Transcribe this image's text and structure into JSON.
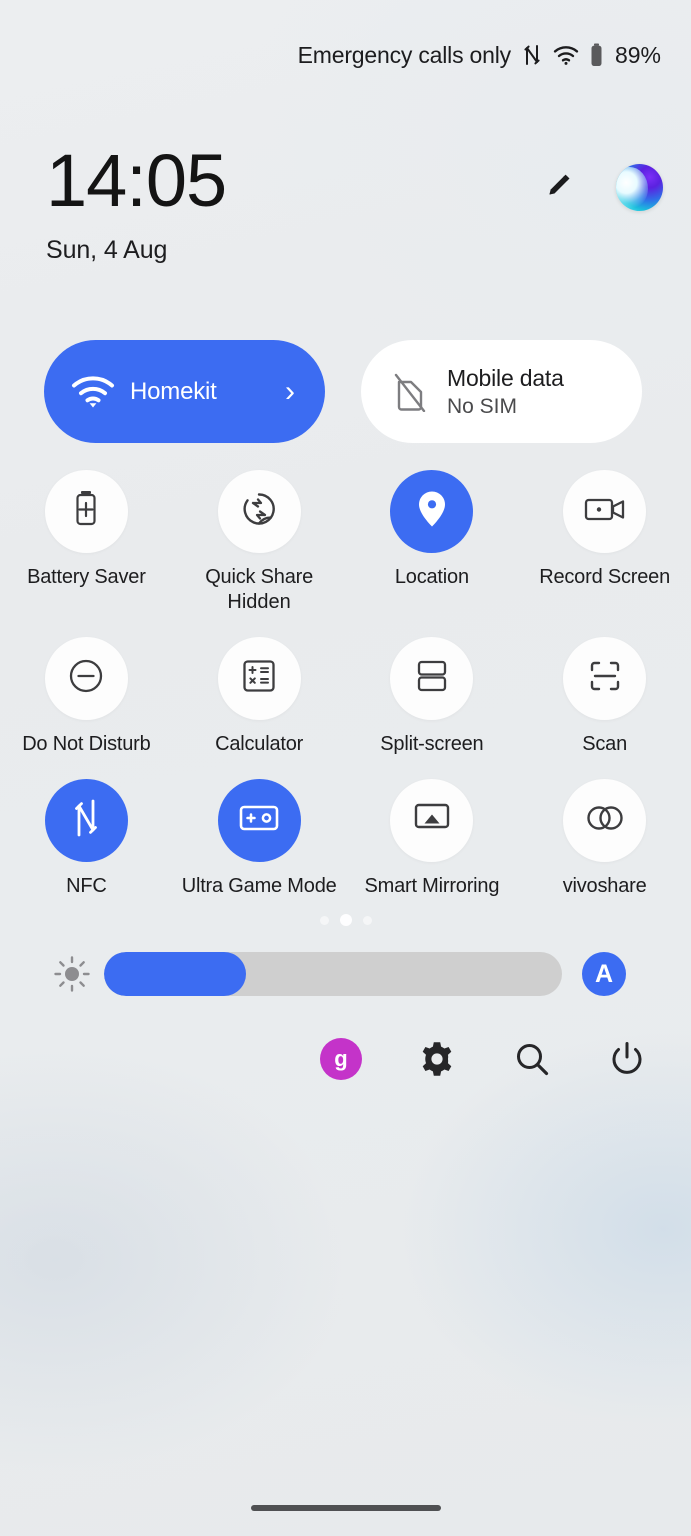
{
  "statusbar": {
    "carrier_text": "Emergency calls only",
    "nfc_icon": "nfc-icon",
    "wifi_icon": "wifi-icon",
    "battery_icon": "battery-icon",
    "battery_percent": "89%"
  },
  "header": {
    "time": "14:05",
    "date": "Sun, 4 Aug",
    "edit_icon": "pencil-edit-icon",
    "assistant_icon": "assistant-orb-icon"
  },
  "big_tiles": [
    {
      "name": "wifi-tile",
      "title": "Homekit",
      "subtitle": "",
      "icon": "wifi-icon",
      "active": true,
      "chevron": "›"
    },
    {
      "name": "mobile-data-tile",
      "title": "Mobile data",
      "subtitle": "No SIM",
      "icon": "sim-off-icon",
      "active": false,
      "chevron": ""
    }
  ],
  "tiles": [
    {
      "label": "Battery Saver",
      "sublabel": "",
      "icon": "battery-saver-icon",
      "active": false
    },
    {
      "label": "Quick Share",
      "sublabel": "Hidden",
      "icon": "quick-share-icon",
      "active": false
    },
    {
      "label": "Location",
      "sublabel": "",
      "icon": "location-pin-icon",
      "active": true
    },
    {
      "label": "Record Screen",
      "sublabel": "",
      "icon": "video-camera-icon",
      "active": false
    },
    {
      "label": "Do Not Disturb",
      "sublabel": "",
      "icon": "minus-circle-icon",
      "active": false
    },
    {
      "label": "Calculator",
      "sublabel": "",
      "icon": "calculator-icon",
      "active": false
    },
    {
      "label": "Split-screen",
      "sublabel": "",
      "icon": "split-screen-icon",
      "active": false
    },
    {
      "label": "Scan",
      "sublabel": "",
      "icon": "scan-frame-icon",
      "active": false
    },
    {
      "label": "NFC",
      "sublabel": "",
      "icon": "nfc-icon",
      "active": true
    },
    {
      "label": "Ultra Game Mode",
      "sublabel": "",
      "icon": "game-controller-icon",
      "active": true
    },
    {
      "label": "Smart Mirroring",
      "sublabel": "",
      "icon": "cast-screen-icon",
      "active": false
    },
    {
      "label": "vivoshare",
      "sublabel": "",
      "icon": "linked-circles-icon",
      "active": false
    }
  ],
  "pager": {
    "total": 3,
    "active_index": 1
  },
  "brightness": {
    "icon": "brightness-sun-icon",
    "value_percent": 31,
    "auto_label": "A"
  },
  "actions": [
    {
      "name": "user-avatar",
      "label": "g",
      "icon": "avatar-icon"
    },
    {
      "name": "settings-button",
      "label": "",
      "icon": "gear-icon"
    },
    {
      "name": "search-button",
      "label": "",
      "icon": "search-icon"
    },
    {
      "name": "power-button",
      "label": "",
      "icon": "power-icon"
    }
  ],
  "colors": {
    "accent_blue": "#3c6cf2",
    "avatar_purple": "#c433c9",
    "tile_off": "#fdfdfd",
    "slider_track": "#cfcfcf"
  },
  "navigation": {
    "home_indicator": "home-gesture-bar"
  }
}
